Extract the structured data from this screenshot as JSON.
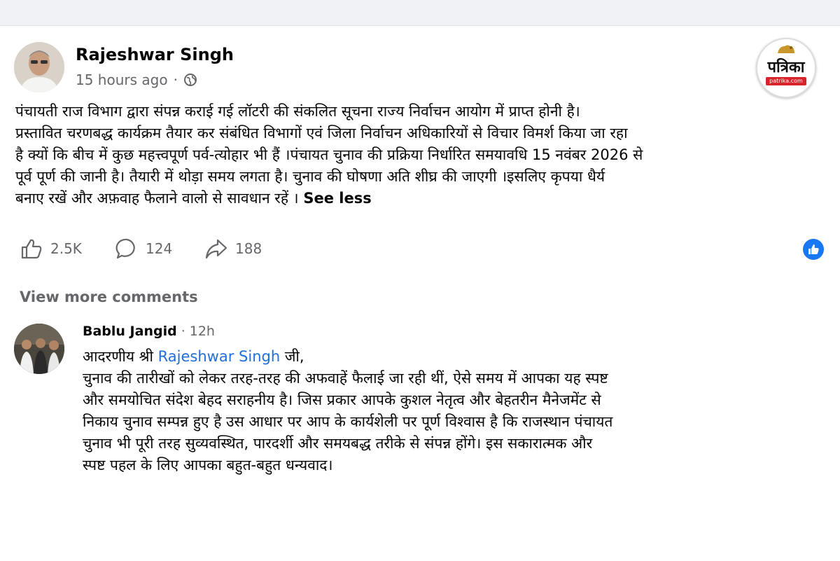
{
  "post": {
    "author": "Rajeshwar Singh",
    "time": "15 hours ago",
    "separator": "·",
    "privacy_icon": "globe-icon",
    "lines": [
      "पंचायती राज विभाग द्वारा संपन्न कराई गई लॉटरी की संकलित सूचना राज्य निर्वाचन आयोग में प्राप्त होनी है।",
      "प्रस्तावित चरणबद्ध कार्यक्रम तैयार कर संबंधित विभागों एवं जिला निर्वाचन अधिकारियों से विचार विमर्श किया जा रहा",
      "है क्यों कि बीच में कुछ महत्त्वपूर्ण पर्व-त्योहार भी हैं ।पंचायत चुनाव की प्रक्रिया निर्धारित समयावधि 15 नवंबर 2026 से",
      "पूर्व पूर्ण की जानी है। तैयारी में थोड़ा समय लगता है। चुनाव की घोषणा अति शीघ्र की जाएगी ।इसलिए कृपया धैर्य",
      "बनाए रखें और अफ़वाह फैलाने वालो से सावधान रहें ।"
    ],
    "see_less": "See less"
  },
  "logo": {
    "brand": "पत्रिका",
    "site": "patrika.com"
  },
  "actions": {
    "likes": "2.5K",
    "comments": "124",
    "shares": "188"
  },
  "comments_section": {
    "view_more": "View more comments"
  },
  "comment": {
    "author": "Bablu Jangid",
    "separator": "·",
    "time": "12h",
    "greeting_prefix": "आदरणीय श्री ",
    "mention": "Rajeshwar Singh",
    "greeting_suffix": " जी,",
    "lines": [
      "चुनाव की तारीखों को लेकर तरह-तरह की अफवाहें फैलाई जा रही थीं, ऐसे समय में आपका यह स्पष्ट",
      "और समयोचित संदेश बेहद सराहनीय है। जिस प्रकार आपके कुशल नेतृत्व और बेहतरीन मैनेजमेंट से",
      "निकाय चुनाव सम्पन्न हुए है उस आधार पर आप के कार्यशेली पर पूर्ण विश्वास है कि राजस्थान पंचायत",
      "चुनाव भी पूरी तरह सुव्यवस्थित, पारदर्शी और समयबद्ध तरीके से संपन्न होंगे। इस सकारात्मक और",
      "स्पष्ट पहल के लिए आपका बहुत-बहुत धन्यवाद।"
    ]
  },
  "colors": {
    "text": "#050505",
    "secondary": "#65676b",
    "link": "#216fdb",
    "like_badge": "#1877f2",
    "background": "#ffffff"
  }
}
